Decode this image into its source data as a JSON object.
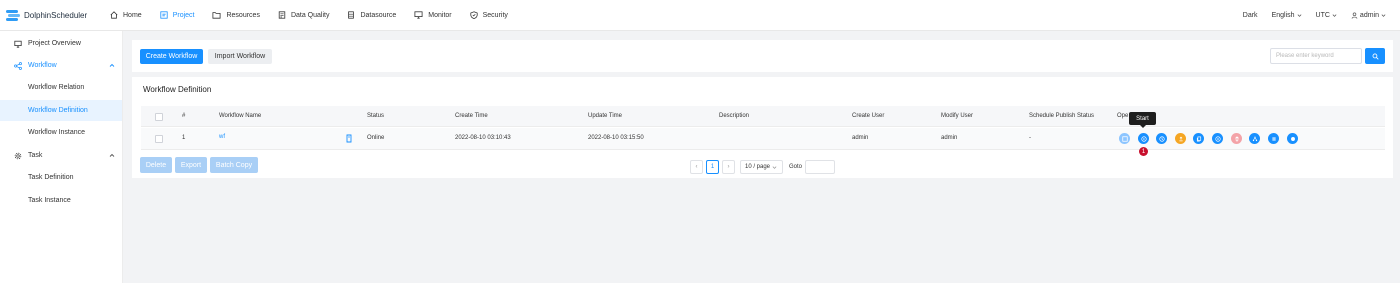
{
  "app": {
    "name": "DolphinScheduler"
  },
  "nav": [
    {
      "label": "Home",
      "icon": "home-icon",
      "active": false
    },
    {
      "label": "Project",
      "icon": "project-icon",
      "active": true
    },
    {
      "label": "Resources",
      "icon": "folder-icon",
      "active": false
    },
    {
      "label": "Data Quality",
      "icon": "data-quality-icon",
      "active": false
    },
    {
      "label": "Datasource",
      "icon": "database-icon",
      "active": false
    },
    {
      "label": "Monitor",
      "icon": "monitor-icon",
      "active": false
    },
    {
      "label": "Security",
      "icon": "shield-icon",
      "active": false
    }
  ],
  "topright": {
    "theme": "Dark",
    "language": "English",
    "timezone": "UTC",
    "user": "admin"
  },
  "sidebar": {
    "project_overview": "Project Overview",
    "workflow": "Workflow",
    "workflow_relation": "Workflow Relation",
    "workflow_definition": "Workflow Definition",
    "workflow_instance": "Workflow Instance",
    "task": "Task",
    "task_definition": "Task Definition",
    "task_instance": "Task Instance"
  },
  "toolbar": {
    "create_label": "Create Workflow",
    "import_label": "Import Workflow",
    "search_placeholder": "Please enter keyword"
  },
  "section_title": "Workflow Definition",
  "table": {
    "headers": {
      "index": "#",
      "name": "Workflow Name",
      "status": "Status",
      "create_time": "Create Time",
      "update_time": "Update Time",
      "description": "Description",
      "create_user": "Create User",
      "modify_user": "Modify User",
      "schedule_status": "Schedule Publish Status",
      "operation": "Ope"
    },
    "rows": [
      {
        "index": "1",
        "name": "wf",
        "status": "Online",
        "create_time": "2022-08-10 03:10:43",
        "update_time": "2022-08-10 03:15:50",
        "description": "",
        "create_user": "admin",
        "modify_user": "admin",
        "schedule_status": "-"
      }
    ]
  },
  "operations": [
    {
      "icon": "edit-icon",
      "color": "#8cc5ff"
    },
    {
      "icon": "start-icon",
      "color": "#1890ff"
    },
    {
      "icon": "timing-icon",
      "color": "#1890ff"
    },
    {
      "icon": "online-icon",
      "color": "#f5a623"
    },
    {
      "icon": "copy-icon",
      "color": "#1890ff"
    },
    {
      "icon": "cron-manage-icon",
      "color": "#1890ff"
    },
    {
      "icon": "delete-icon",
      "color": "#f4a3a8"
    },
    {
      "icon": "tree-icon",
      "color": "#1890ff"
    },
    {
      "icon": "export-icon",
      "color": "#1890ff"
    },
    {
      "icon": "version-info-icon",
      "color": "#1890ff"
    }
  ],
  "tooltip": {
    "text": "Start"
  },
  "badge": {
    "text": "1"
  },
  "bulk": {
    "delete_label": "Delete",
    "export_label": "Export",
    "batch_copy_label": "Batch Copy"
  },
  "pager": {
    "current": "1",
    "size": "10 / page",
    "goto_label": "Goto",
    "prev": "‹",
    "next": "›"
  }
}
